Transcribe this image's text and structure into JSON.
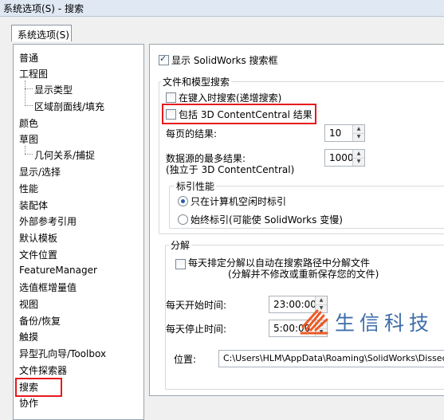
{
  "window": {
    "title": "系统选项(S) - 搜索"
  },
  "tab": {
    "label": "系统选项(S)"
  },
  "sidebar": {
    "items": [
      {
        "label": "普通"
      },
      {
        "label": "工程图"
      },
      {
        "label": "显示类型"
      },
      {
        "label": "区域剖面线/填充"
      },
      {
        "label": "颜色"
      },
      {
        "label": "草图"
      },
      {
        "label": "几何关系/捕捉"
      },
      {
        "label": "显示/选择"
      },
      {
        "label": "性能"
      },
      {
        "label": "装配体"
      },
      {
        "label": "外部参考引用"
      },
      {
        "label": "默认模板"
      },
      {
        "label": "文件位置"
      },
      {
        "label": "FeatureManager"
      },
      {
        "label": "选值框增量值"
      },
      {
        "label": "视图"
      },
      {
        "label": "备份/恢复"
      },
      {
        "label": "触摸"
      },
      {
        "label": "异型孔向导/Toolbox"
      },
      {
        "label": "文件探索器"
      },
      {
        "label": "搜索"
      },
      {
        "label": "协作"
      }
    ]
  },
  "main": {
    "show_search_box": {
      "label": "显示 SolidWorks 搜索框",
      "checked": true
    },
    "file_model_search": {
      "title": "文件和模型搜索",
      "incremental": {
        "label": "在键入时搜索(递增搜索)",
        "checked": false
      },
      "include_3dcc": {
        "label": "包括 3D ContentCentral 结果",
        "checked": false
      },
      "results_per_page": {
        "label": "每页的结果:",
        "value": "10"
      },
      "max_results": {
        "label_line1": "数据源的最多结果:",
        "label_line2": "(独立于 3D ContentCentral)",
        "value": "1000"
      },
      "index_performance": {
        "title": "标引性能",
        "idle_only": {
          "label": "只在计算机空闲时标引",
          "selected": true
        },
        "always": {
          "label": "始终标引(可能使 SolidWorks 变慢)",
          "selected": false
        }
      }
    },
    "dissection": {
      "title": "分解",
      "schedule": {
        "label_line1": "每天排定分解以自动在搜索路径中分解文件",
        "label_line2": "(分解并不修改或重新保存您的文件)",
        "checked": false
      },
      "start_time": {
        "label": "每天开始时间:",
        "value": "23:00:00"
      },
      "stop_time": {
        "label": "每天停止时间:",
        "value": "5:00:00"
      },
      "location": {
        "label": "位置:",
        "value": "C:\\Users\\HLM\\AppData\\Roaming\\SolidWorks\\Dissection"
      }
    }
  },
  "watermark": {
    "text": "生信科技"
  },
  "colors": {
    "highlight": "#e8191c",
    "watermark": "#3f6ea8"
  }
}
